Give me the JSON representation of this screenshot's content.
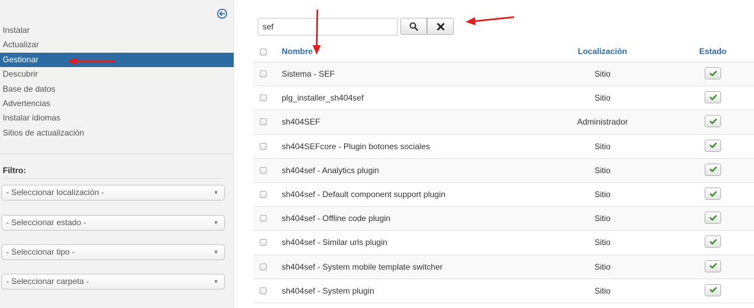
{
  "sidebar": {
    "menu": [
      {
        "label": "Instalar"
      },
      {
        "label": "Actualizar"
      },
      {
        "label": "Gestionar",
        "active": true
      },
      {
        "label": "Descubrir"
      },
      {
        "label": "Base de datos"
      },
      {
        "label": "Advertencias"
      },
      {
        "label": "Instalar idiomas"
      },
      {
        "label": "Sitios de actualización"
      }
    ],
    "filter_title": "Filtro:",
    "filters": [
      {
        "label": "- Seleccionar localización -"
      },
      {
        "label": "- Seleccionar estado -"
      },
      {
        "label": "- Seleccionar tipo -"
      },
      {
        "label": "- Seleccionar carpeta -"
      }
    ]
  },
  "search": {
    "value": "sef"
  },
  "table": {
    "columns": {
      "name": "Nombre",
      "location": "Localización",
      "state": "Estado"
    },
    "rows": [
      {
        "name": "Sistema - SEF",
        "location": "Sitio",
        "enabled": true
      },
      {
        "name": "plg_installer_sh404sef",
        "location": "Sitio",
        "enabled": true
      },
      {
        "name": "sh404SEF",
        "location": "Administrador",
        "enabled": true
      },
      {
        "name": "sh404SEFcore - Plugin botones sociales",
        "location": "Sitio",
        "enabled": true
      },
      {
        "name": "sh404sef - Analytics plugin",
        "location": "Sitio",
        "enabled": true
      },
      {
        "name": "sh404sef - Default component support plugin",
        "location": "Sitio",
        "enabled": true
      },
      {
        "name": "sh404sef - Offline code plugin",
        "location": "Sitio",
        "enabled": true
      },
      {
        "name": "sh404sef - Similar urls plugin",
        "location": "Sitio",
        "enabled": true
      },
      {
        "name": "sh404sef - System mobile template switcher",
        "location": "Sitio",
        "enabled": true
      },
      {
        "name": "sh404sef - System plugin",
        "location": "Sitio",
        "enabled": true
      }
    ]
  },
  "colors": {
    "accent": "#2d6ca2",
    "annotation_arrow": "#e02020",
    "check": "#3c8a2e"
  },
  "icons": {
    "collapse": "circle-arrow-left-icon",
    "search": "search-icon",
    "clear": "close-icon",
    "state": "check-icon"
  }
}
